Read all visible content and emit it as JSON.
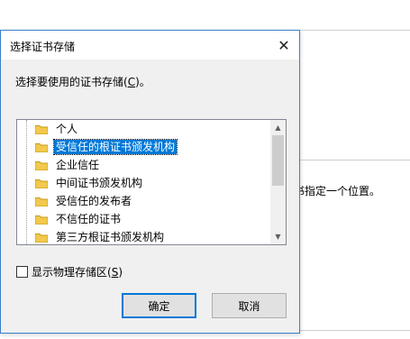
{
  "background_window": {
    "text": "书指定一个位置。"
  },
  "dialog": {
    "title": "选择证书存储",
    "prompt_before": "选择要使用的证书存储(",
    "prompt_key": "C",
    "prompt_after": ")。",
    "stores": [
      {
        "label": "个人",
        "selected": false
      },
      {
        "label": "受信任的根证书颁发机构",
        "selected": true
      },
      {
        "label": "企业信任",
        "selected": false
      },
      {
        "label": "中间证书颁发机构",
        "selected": false
      },
      {
        "label": "受信任的发布者",
        "selected": false
      },
      {
        "label": "不信任的证书",
        "selected": false
      },
      {
        "label": "第三方根证书颁发机构",
        "selected": false
      }
    ],
    "show_physical": {
      "label_before": "显示物理存储区(",
      "key": "S",
      "label_after": ")",
      "checked": false
    },
    "ok_label": "确定",
    "cancel_label": "取消"
  },
  "colors": {
    "accent": "#0078d7",
    "folder": "#f2c94c"
  }
}
